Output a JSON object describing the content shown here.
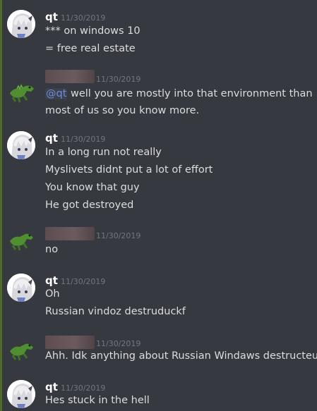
{
  "messages": [
    {
      "author": "qt",
      "timestamp": "11/30/2019",
      "lines": [
        "*** on windows 10",
        "= free real estate"
      ]
    },
    {
      "author": "",
      "timestamp": "11/30/2019",
      "mention": "@qt",
      "lines": [
        "well you are mostly into that environment than most of us so you know more."
      ]
    },
    {
      "author": "qt",
      "timestamp": "11/30/2019",
      "lines": [
        "In a long run not really",
        "Myslivets didnt put a lot of effort",
        "You know that guy",
        "He got destroyed"
      ]
    },
    {
      "author": "",
      "timestamp": "11/30/2019",
      "lines": [
        "no"
      ]
    },
    {
      "author": "qt",
      "timestamp": "11/30/2019",
      "lines": [
        "Oh",
        "Russian vindoz destruduckf"
      ]
    },
    {
      "author": "",
      "timestamp": "11/30/2019",
      "lines": [
        "Ahh. Idk anything about Russian Windaws destructeur"
      ]
    },
    {
      "author": "qt",
      "timestamp": "11/30/2019",
      "lines": [
        "Hes stuck in the hell"
      ]
    }
  ],
  "colors": {
    "background": "#36393f",
    "username": "#ffffff",
    "text": "#dcddde",
    "timestamp": "#72767d",
    "mention": "#7289da"
  },
  "icons": {
    "qt_avatar": "anime-character-avatar",
    "other_avatar": "green-dinosaur-avatar"
  }
}
